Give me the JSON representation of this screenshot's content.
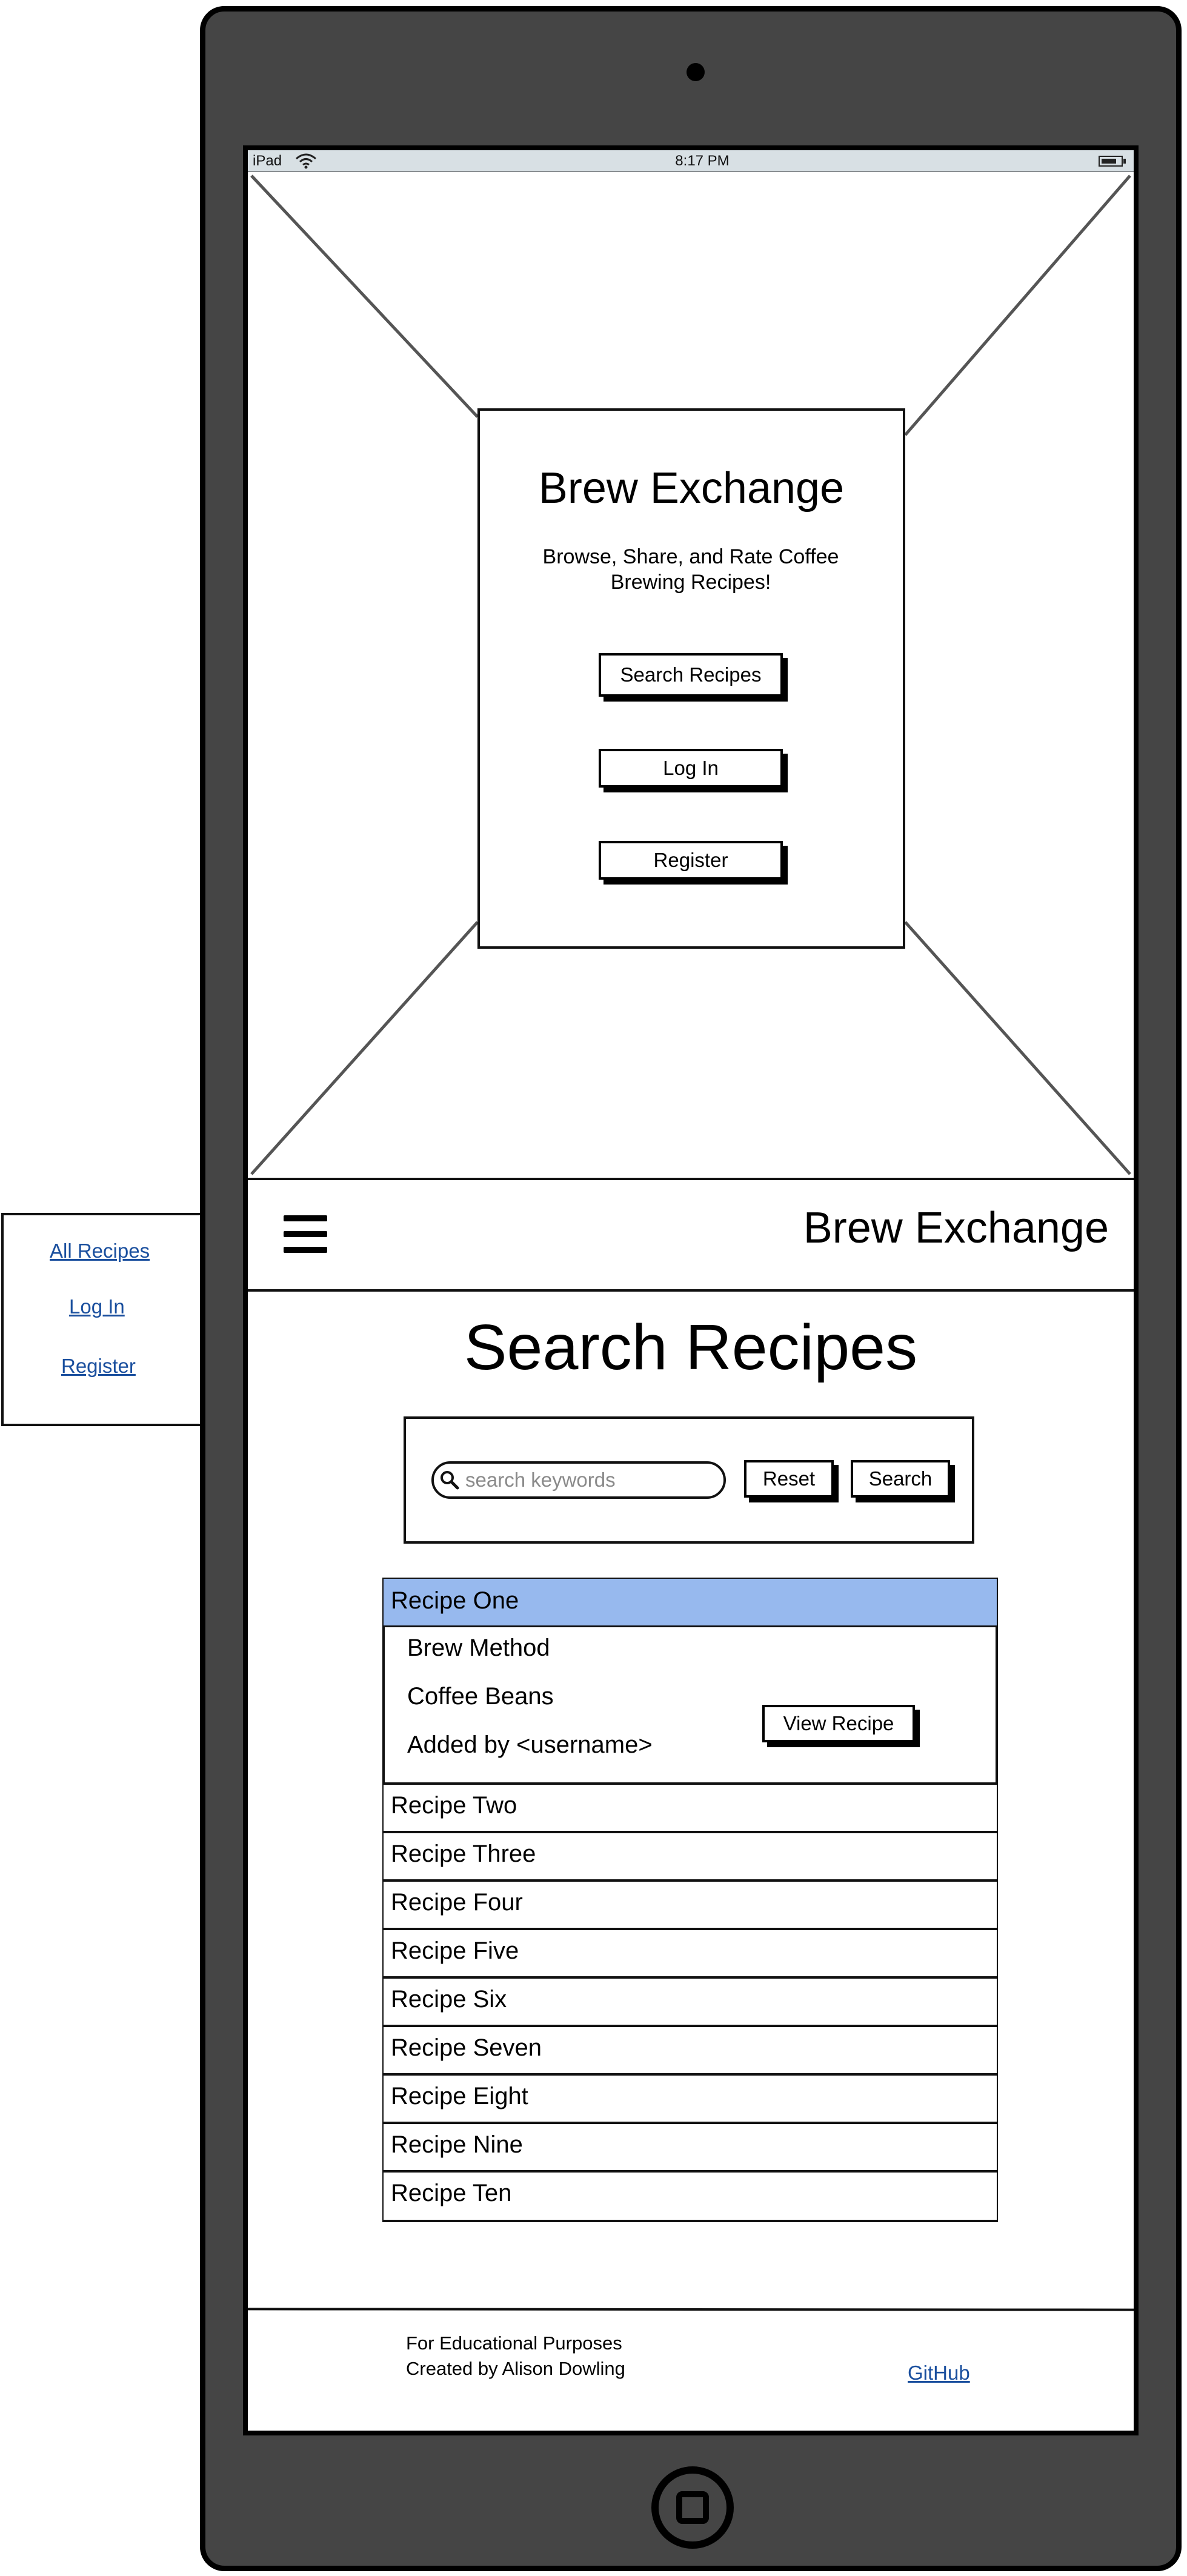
{
  "status_bar": {
    "carrier": "iPad",
    "time": "8:17 PM"
  },
  "landing": {
    "title": "Brew Exchange",
    "subtitle_line1": "Browse, Share, and Rate Coffee",
    "subtitle_line2": "Brewing Recipes!",
    "buttons": [
      {
        "label": "Search Recipes"
      },
      {
        "label": "Log In"
      },
      {
        "label": "Register"
      }
    ]
  },
  "header": {
    "app_title": "Brew Exchange",
    "menu_icon": "hamburger-menu-icon"
  },
  "side_menu": {
    "items": [
      {
        "label": "All Recipes"
      },
      {
        "label": "Log In"
      },
      {
        "label": "Register"
      }
    ]
  },
  "search_page": {
    "title": "Search Recipes",
    "search": {
      "placeholder": "search keywords",
      "icon": "search-icon",
      "reset_label": "Reset",
      "search_label": "Search"
    },
    "recipes": [
      {
        "name": "Recipe One",
        "selected": true,
        "details": {
          "brew_method": "Brew Method",
          "coffee_beans": "Coffee Beans",
          "added_by": "Added by <username>",
          "view_button": "View Recipe"
        }
      },
      {
        "name": "Recipe Two"
      },
      {
        "name": "Recipe Three"
      },
      {
        "name": "Recipe Four"
      },
      {
        "name": "Recipe Five"
      },
      {
        "name": "Recipe Six"
      },
      {
        "name": "Recipe Seven"
      },
      {
        "name": "Recipe Eight"
      },
      {
        "name": "Recipe Nine"
      },
      {
        "name": "Recipe Ten"
      }
    ]
  },
  "footer": {
    "line1": "For Educational Purposes",
    "line2": "Created by Alison Dowling",
    "github_label": "GitHub"
  },
  "colors": {
    "device": "#454545",
    "selected_row": "#97b9ee",
    "link": "#1a4f9e"
  }
}
